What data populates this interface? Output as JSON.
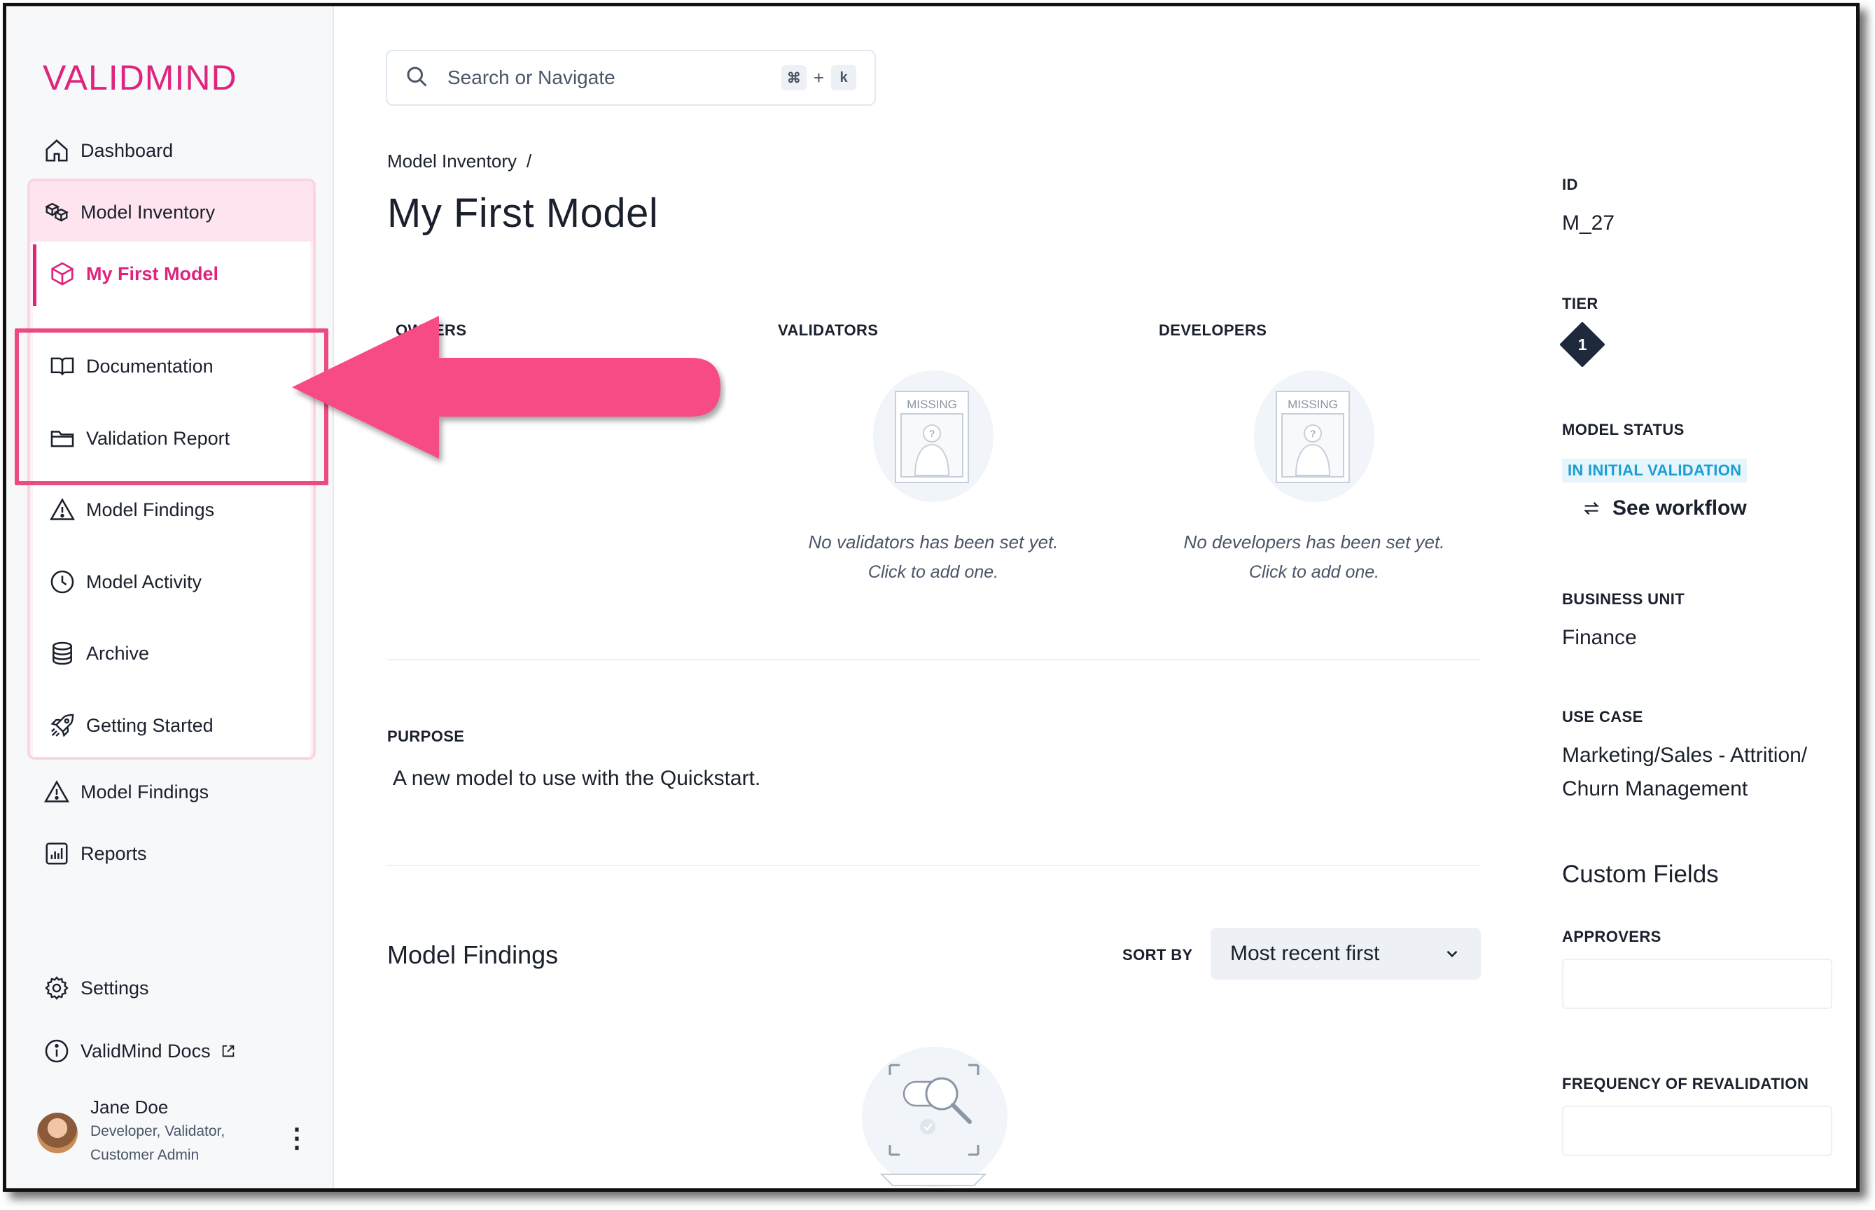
{
  "brand": {
    "logo_text": "VALIDMIND",
    "accent_color": "#de257e"
  },
  "search": {
    "placeholder": "Search or Navigate",
    "shortcut_cmd": "⌘",
    "shortcut_plus": "+",
    "shortcut_key": "k"
  },
  "sidebar": {
    "dashboard": "Dashboard",
    "model_inventory": "Model Inventory",
    "active_model": "My First Model",
    "sub_items": [
      {
        "label": "Documentation",
        "icon": "book-open-icon"
      },
      {
        "label": "Validation Report",
        "icon": "folder-icon"
      },
      {
        "label": "Model Findings",
        "icon": "warning-triangle-icon"
      },
      {
        "label": "Model Activity",
        "icon": "clock-icon"
      },
      {
        "label": "Archive",
        "icon": "database-icon"
      },
      {
        "label": "Getting Started",
        "icon": "rocket-icon"
      }
    ],
    "model_findings": "Model Findings",
    "reports": "Reports",
    "settings": "Settings",
    "docs": "ValidMind Docs",
    "user": {
      "name": "Jane Doe",
      "role_line1": "Developer, Validator,",
      "role_line2": "Customer Admin"
    }
  },
  "main": {
    "breadcrumb": "Model Inventory",
    "breadcrumb_sep": "/",
    "title": "My First Model",
    "owners_label": "OWNERS",
    "validators_label": "VALIDATORS",
    "developers_label": "DEVELOPERS",
    "missing_tag": "MISSING",
    "missing_q": "?",
    "validators_empty": "No validators has been set yet.",
    "validators_cta": "Click to add one.",
    "developers_empty": "No developers has been set yet.",
    "developers_cta": "Click to add one.",
    "purpose_label": "PURPOSE",
    "purpose_text": "A new model to use with the Quickstart.",
    "findings_title": "Model Findings",
    "sort_label": "SORT BY",
    "sort_value": "Most recent first"
  },
  "meta": {
    "id_label": "ID",
    "id_value": "M_27",
    "tier_label": "TIER",
    "tier_value": "1",
    "status_label": "MODEL STATUS",
    "status_value": "IN INITIAL VALIDATION",
    "status_color": "#1a9ed4",
    "workflow_link": "See workflow",
    "bu_label": "BUSINESS UNIT",
    "bu_value": "Finance",
    "use_case_label": "USE CASE",
    "use_case_line1": "Marketing/Sales - Attrition/",
    "use_case_line2": "Churn Management",
    "custom_fields_title": "Custom Fields",
    "approvers_label": "APPROVERS",
    "frequency_label": "FREQUENCY OF REVALIDATION"
  },
  "annotation": {
    "highlight_color": "#ec4b82"
  }
}
